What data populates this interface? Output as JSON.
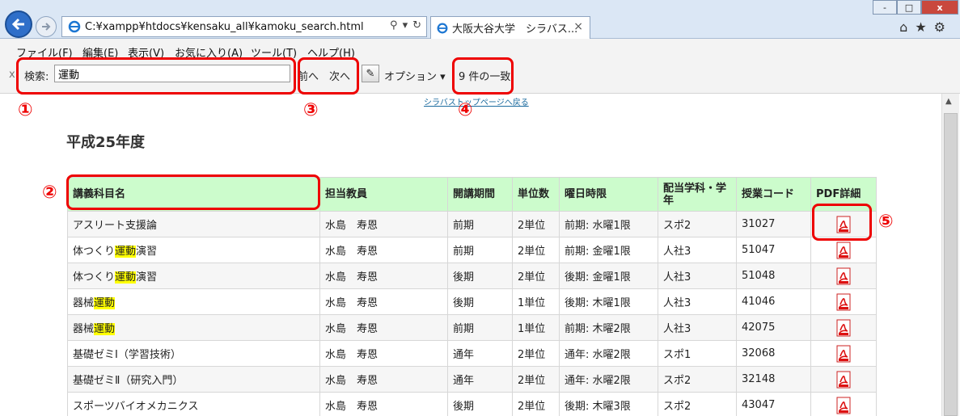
{
  "browser": {
    "address_url": "C:¥xampp¥htdocs¥kensaku_all¥kamoku_search.html",
    "tab_title": "大阪大谷大学　シラバス...",
    "tab_close": "×",
    "window_buttons": [
      "-",
      "□",
      "x"
    ]
  },
  "menu": [
    "ファイル(F)",
    "編集(E)",
    "表示(V)",
    "お気に入り(A)",
    "ツール(T)",
    "ヘルプ(H)"
  ],
  "findbar": {
    "close": "x",
    "label": "検索:",
    "query": "運動",
    "prev": "前へ",
    "next": "次へ",
    "options": "オプション ▾",
    "count": "9 件の一致"
  },
  "annotations": [
    "①",
    "②",
    "③",
    "④",
    "⑤"
  ],
  "page": {
    "top_link": "シラバストップページへ戻る",
    "heading": "平成25年度"
  },
  "table": {
    "columns": [
      "講義科目名",
      "担当教員",
      "開講期間",
      "単位数",
      "曜日時限",
      "配当学科・学年",
      "授業コード",
      "PDF詳細"
    ],
    "rows": [
      {
        "pre": "アスリート支援論",
        "hl": "",
        "post": "",
        "teacher": "水島　寿恩",
        "term": "前期",
        "credits": "2単位",
        "slot": "前期: 水曜1限",
        "dept": "スポ2",
        "code": "31027"
      },
      {
        "pre": "体つくり",
        "hl": "運動",
        "post": "演習",
        "teacher": "水島　寿恩",
        "term": "前期",
        "credits": "2単位",
        "slot": "前期: 金曜1限",
        "dept": "人社3",
        "code": "51047"
      },
      {
        "pre": "体つくり",
        "hl": "運動",
        "post": "演習",
        "teacher": "水島　寿恩",
        "term": "後期",
        "credits": "2単位",
        "slot": "後期: 金曜1限",
        "dept": "人社3",
        "code": "51048"
      },
      {
        "pre": "器械",
        "hl": "運動",
        "post": "",
        "teacher": "水島　寿恩",
        "term": "後期",
        "credits": "1単位",
        "slot": "後期: 木曜1限",
        "dept": "人社3",
        "code": "41046"
      },
      {
        "pre": "器械",
        "hl": "運動",
        "post": "",
        "teacher": "水島　寿恩",
        "term": "前期",
        "credits": "1単位",
        "slot": "前期: 木曜2限",
        "dept": "人社3",
        "code": "42075"
      },
      {
        "pre": "基礎ゼミⅠ（学習技術）",
        "hl": "",
        "post": "",
        "teacher": "水島　寿恩",
        "term": "通年",
        "credits": "2単位",
        "slot": "通年: 水曜2限",
        "dept": "スポ1",
        "code": "32068"
      },
      {
        "pre": "基礎ゼミⅡ（研究入門）",
        "hl": "",
        "post": "",
        "teacher": "水島　寿恩",
        "term": "通年",
        "credits": "2単位",
        "slot": "通年: 水曜2限",
        "dept": "スポ2",
        "code": "32148"
      },
      {
        "pre": "スポーツバイオメカニクス",
        "hl": "",
        "post": "",
        "teacher": "水島　寿恩",
        "term": "後期",
        "credits": "2単位",
        "slot": "後期: 木曜3限",
        "dept": "スポ2",
        "code": "43047"
      }
    ]
  }
}
